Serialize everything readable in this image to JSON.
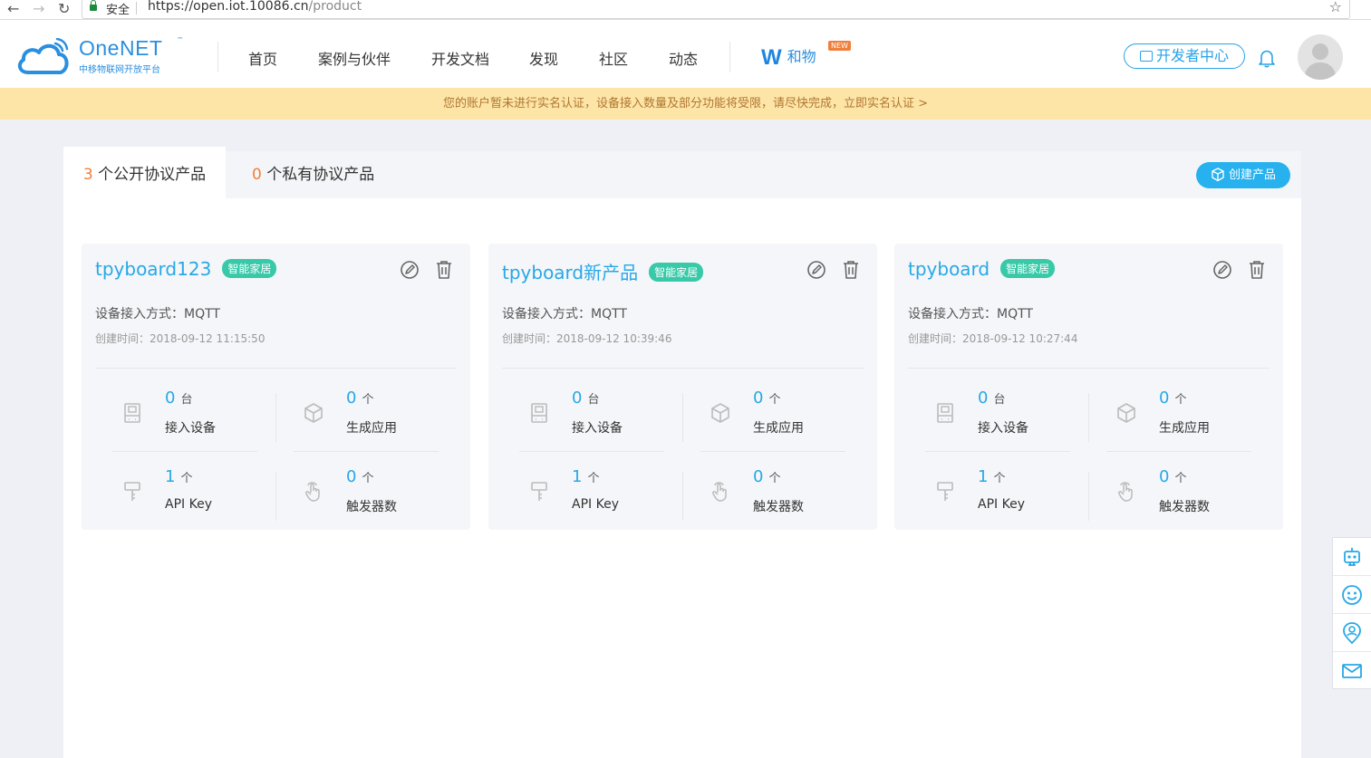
{
  "browser": {
    "secure_label": "安全",
    "url_host": "https://open.iot.10086.cn",
    "url_path": "/product"
  },
  "header": {
    "brand": "OneNET",
    "trademark": "™",
    "slogan": "中移物联网开放平台",
    "nav": [
      "首页",
      "案例与伙伴",
      "开发文档",
      "发现",
      "社区",
      "动态"
    ],
    "hewu_label": "和物",
    "hewu_badge": "NEW",
    "dev_center": "开发者中心"
  },
  "notice": "您的账户暂未进行实名认证，设备接入数量及部分功能将受限，请尽快完成，立即实名认证 >",
  "tabs": {
    "public_count": "3",
    "public_label": "个公开协议产品",
    "private_count": "0",
    "private_label": "个私有协议产品"
  },
  "create_button": "创建产品",
  "stat_labels": {
    "devices": "接入设备",
    "apps": "生成应用",
    "apikey": "API Key",
    "triggers": "触发器数"
  },
  "units": {
    "tai": "台",
    "ge": "个"
  },
  "products": [
    {
      "name": "tpyboard123",
      "tag": "智能家居",
      "access": "设备接入方式：MQTT",
      "created": "创建时间：2018-09-12 11:15:50",
      "devices": "0",
      "apps": "0",
      "apikeys": "1",
      "triggers": "0"
    },
    {
      "name": "tpyboard新产品",
      "tag": "智能家居",
      "access": "设备接入方式：MQTT",
      "created": "创建时间：2018-09-12 10:39:46",
      "devices": "0",
      "apps": "0",
      "apikeys": "1",
      "triggers": "0"
    },
    {
      "name": "tpyboard",
      "tag": "智能家居",
      "access": "设备接入方式：MQTT",
      "created": "创建时间：2018-09-12 10:27:44",
      "devices": "0",
      "apps": "0",
      "apikeys": "1",
      "triggers": "0"
    }
  ],
  "colors": {
    "accent": "#27a8e6",
    "tag": "#37c9a8",
    "count_highlight": "#f07f3c",
    "notice_bg": "#fde5a8",
    "notice_text": "#b07630"
  }
}
